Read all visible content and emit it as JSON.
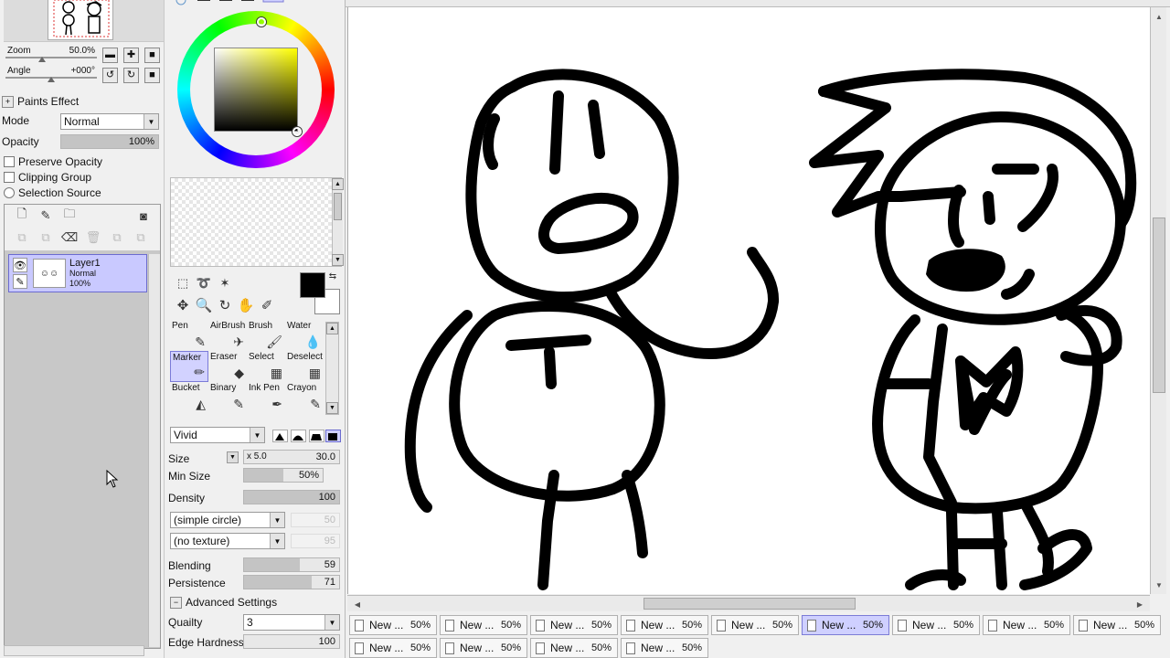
{
  "navigator": {
    "zoom_label": "Zoom",
    "zoom_value": "50.0%",
    "angle_label": "Angle",
    "angle_value": "+000°"
  },
  "layer_props": {
    "title": "Paints Effect",
    "mode_label": "Mode",
    "mode_value": "Normal",
    "opacity_label": "Opacity",
    "opacity_value": "100%",
    "opacity_level": 1.0,
    "preserve_opacity": "Preserve Opacity",
    "clipping_group": "Clipping Group",
    "selection_source": "Selection Source"
  },
  "layers": [
    {
      "name": "Layer1",
      "mode": "Normal",
      "opacity": "100%"
    }
  ],
  "brushes": [
    {
      "label": "Pen",
      "icon": "pen-icon"
    },
    {
      "label": "AirBrush",
      "icon": "airbrush-icon"
    },
    {
      "label": "Brush",
      "icon": "brush-icon"
    },
    {
      "label": "Water",
      "icon": "water-icon"
    },
    {
      "label": "Marker",
      "icon": "marker-icon",
      "selected": true
    },
    {
      "label": "Eraser",
      "icon": "eraser-icon"
    },
    {
      "label": "Select",
      "icon": "select-icon"
    },
    {
      "label": "Deselect",
      "icon": "deselect-icon"
    },
    {
      "label": "Bucket",
      "icon": "bucket-icon"
    },
    {
      "label": "Binary",
      "icon": "binary-icon"
    },
    {
      "label": "Ink Pen",
      "icon": "ink-pen-icon"
    },
    {
      "label": "Crayon",
      "icon": "crayon-icon"
    }
  ],
  "tool_props": {
    "blend_mode": "Vivid",
    "size_label": "Size",
    "size_mult": "x 5.0",
    "size_value": "30.0",
    "min_size_label": "Min Size",
    "min_size_value": "50%",
    "min_size_level": 0.5,
    "density_label": "Density",
    "density_value": "100",
    "density_level": 1.0,
    "shape": "(simple circle)",
    "shape_value": "50",
    "texture": "(no texture)",
    "texture_value": "95",
    "blending_label": "Blending",
    "blending_value": "59",
    "blending_level": 0.59,
    "persistence_label": "Persistence",
    "persistence_value": "71",
    "persistence_level": 0.71,
    "advanced_label": "Advanced Settings",
    "quality_label": "Quailty",
    "quality_value": "3",
    "edge_label": "Edge Hardness",
    "edge_value": "100"
  },
  "doc_tabs_row1": [
    {
      "name": "New ...",
      "zoom": "50%"
    },
    {
      "name": "New ...",
      "zoom": "50%"
    },
    {
      "name": "New ...",
      "zoom": "50%"
    },
    {
      "name": "New ...",
      "zoom": "50%"
    },
    {
      "name": "New ...",
      "zoom": "50%"
    },
    {
      "name": "New ...",
      "zoom": "50%",
      "selected": true
    },
    {
      "name": "New ...",
      "zoom": "50%"
    },
    {
      "name": "New ...",
      "zoom": "50%"
    },
    {
      "name": "New ...",
      "zoom": "50%"
    }
  ],
  "doc_tabs_row2": [
    {
      "name": "New ...",
      "zoom": "50%"
    },
    {
      "name": "New ...",
      "zoom": "50%"
    },
    {
      "name": "New ...",
      "zoom": "50%"
    },
    {
      "name": "New ...",
      "zoom": "50%"
    }
  ],
  "colors": {
    "foreground": "#000000",
    "background": "#ffffff",
    "selection_highlight": "#c9c9ff"
  }
}
